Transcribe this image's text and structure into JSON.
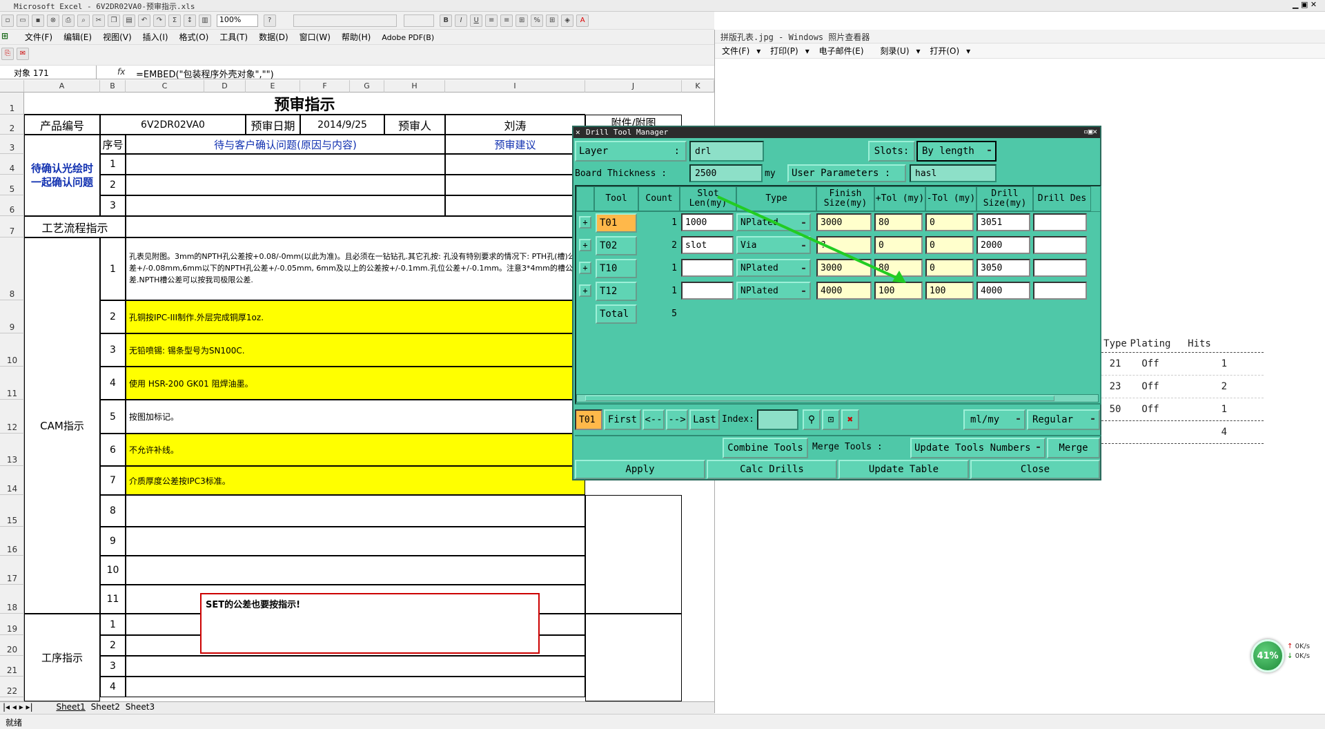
{
  "excel": {
    "title": "Microsoft Excel - 6V2DR02VA0-预审指示.xls",
    "menu": [
      "文件(F)",
      "编辑(E)",
      "视图(V)",
      "插入(I)",
      "格式(O)",
      "工具(T)",
      "数据(D)",
      "窗口(W)",
      "帮助(H)",
      "Adobe PDF(B)"
    ],
    "zoom": "100%",
    "name_box": "对象 171",
    "formula": "=EMBED(\"包装程序外壳对象\",\"\")",
    "columns": [
      "A",
      "B",
      "C",
      "D",
      "E",
      "F",
      "G",
      "H",
      "I",
      "J",
      "K"
    ],
    "rows": [
      "1",
      "2",
      "3",
      "4",
      "5",
      "6",
      "7",
      "8",
      "9",
      "10",
      "11",
      "12",
      "13",
      "14",
      "15",
      "16",
      "17",
      "18",
      "19",
      "20",
      "21",
      "22"
    ],
    "sheet": {
      "title": "预审指示",
      "product_label": "产品编号",
      "product_value": "6V2DR02VA0",
      "date_label": "预审日期",
      "date_value": "2014/9/25",
      "reviewer_label": "预审人",
      "reviewer_value": "刘涛",
      "attach_label": "附件/附图",
      "seq_label": "序号",
      "pending_label": "待确认光绘时一起确认问题",
      "pending_q_header": "待与客户确认问题(原因与内容)",
      "pending_s_header": "预审建议",
      "pending_nums": [
        "1",
        "2",
        "3"
      ],
      "process_label": "工艺流程指示",
      "cam_label": "CAM指示",
      "cam_nums": [
        "1",
        "2",
        "3",
        "4",
        "5",
        "6",
        "7",
        "8",
        "9",
        "10",
        "11"
      ],
      "cam_items": [
        "孔表见附图。3mm的NPTH孔公差按+0.08/-0mm(以此为准)。且必须在一钻钻孔.其它孔按: 孔没有特别要求的情况下: PTH孔(槽)公差+/-0.08mm,6mm以下的NPTH孔公差+/-0.05mm, 6mm及以上的公差按+/-0.1mm.孔位公差+/-0.1mm。注意3*4mm的槽公差.NPTH槽公差可以按我司极限公差.",
        "孔铜按IPC-III制作.外层完成铜厚1oz.",
        "无铅喷锡: 锡条型号为SN100C.",
        "使用 HSR-200 GK01 阻焊油墨。",
        "按图加标记。",
        "不允许补线。",
        "介质厚度公差按IPC3标准。"
      ],
      "proc_label": "工序指示",
      "proc_nums": [
        "1",
        "2",
        "3",
        "4"
      ],
      "note": "SET的公差也要按指示!"
    },
    "sheet_tabs": [
      "Sheet1",
      "Sheet2",
      "Sheet3"
    ],
    "status": "就绪"
  },
  "viewer": {
    "title": "拼版孔表.jpg - Windows 照片查看器",
    "menu": [
      "文件(F)",
      "打印(P)",
      "电子邮件(E)",
      "刻录(U)",
      "打开(O)"
    ],
    "table_headers": [
      "Type",
      "Plating",
      "Hits"
    ],
    "table_rows": [
      [
        "21",
        "Off",
        "1"
      ],
      [
        "23",
        "Off",
        "2"
      ],
      [
        "50",
        "Off",
        "1"
      ]
    ],
    "table_total": "4"
  },
  "dtm": {
    "title": "Drill Tool Manager",
    "layer_label": "Layer",
    "layer_value": "drl",
    "slots_label": "Slots:",
    "slots_value": "By length",
    "thickness_label": "Board Thickness :",
    "thickness_value": "2500",
    "thickness_unit": "my",
    "user_params_label": "User Parameters :",
    "user_params_value": "hasl",
    "headers": [
      "Tool",
      "Count",
      "Slot Len(my)",
      "Type",
      "Finish Size(my)",
      "+Tol (my)",
      "-Tol (my)",
      "Drill Size(my)",
      "Drill Des"
    ],
    "rows": [
      {
        "tool": "T01",
        "count": "1",
        "slot": "1000",
        "type": "NPlated",
        "finish": "3000",
        "ptol": "80",
        "mtol": "0",
        "drill": "3051",
        "des": ""
      },
      {
        "tool": "T02",
        "count": "2",
        "slot": "slot",
        "type": "Via",
        "finish": "?",
        "ptol": "0",
        "mtol": "0",
        "drill": "2000",
        "des": ""
      },
      {
        "tool": "T10",
        "count": "1",
        "slot": "",
        "type": "NPlated",
        "finish": "3000",
        "ptol": "80",
        "mtol": "0",
        "drill": "3050",
        "des": ""
      },
      {
        "tool": "T12",
        "count": "1",
        "slot": "",
        "type": "NPlated",
        "finish": "4000",
        "ptol": "100",
        "mtol": "100",
        "drill": "4000",
        "des": ""
      }
    ],
    "total_label": "Total",
    "total_value": "5",
    "nav": {
      "current": "T01",
      "first": "First",
      "prev": "<--",
      "next": "-->",
      "last": "Last",
      "index_label": "Index:",
      "units": "ml/my",
      "mode": "Regular"
    },
    "combine_label": "Combine Tools",
    "merge_label": "Merge Tools :",
    "update_numbers": "Update Tools Numbers",
    "merge_btn": "Merge",
    "apply": "Apply",
    "calc": "Calc Drills",
    "update_table": "Update Table",
    "close": "Close"
  },
  "tray": {
    "percent": "41%",
    "up": "0K/s",
    "down": "0K/s"
  }
}
